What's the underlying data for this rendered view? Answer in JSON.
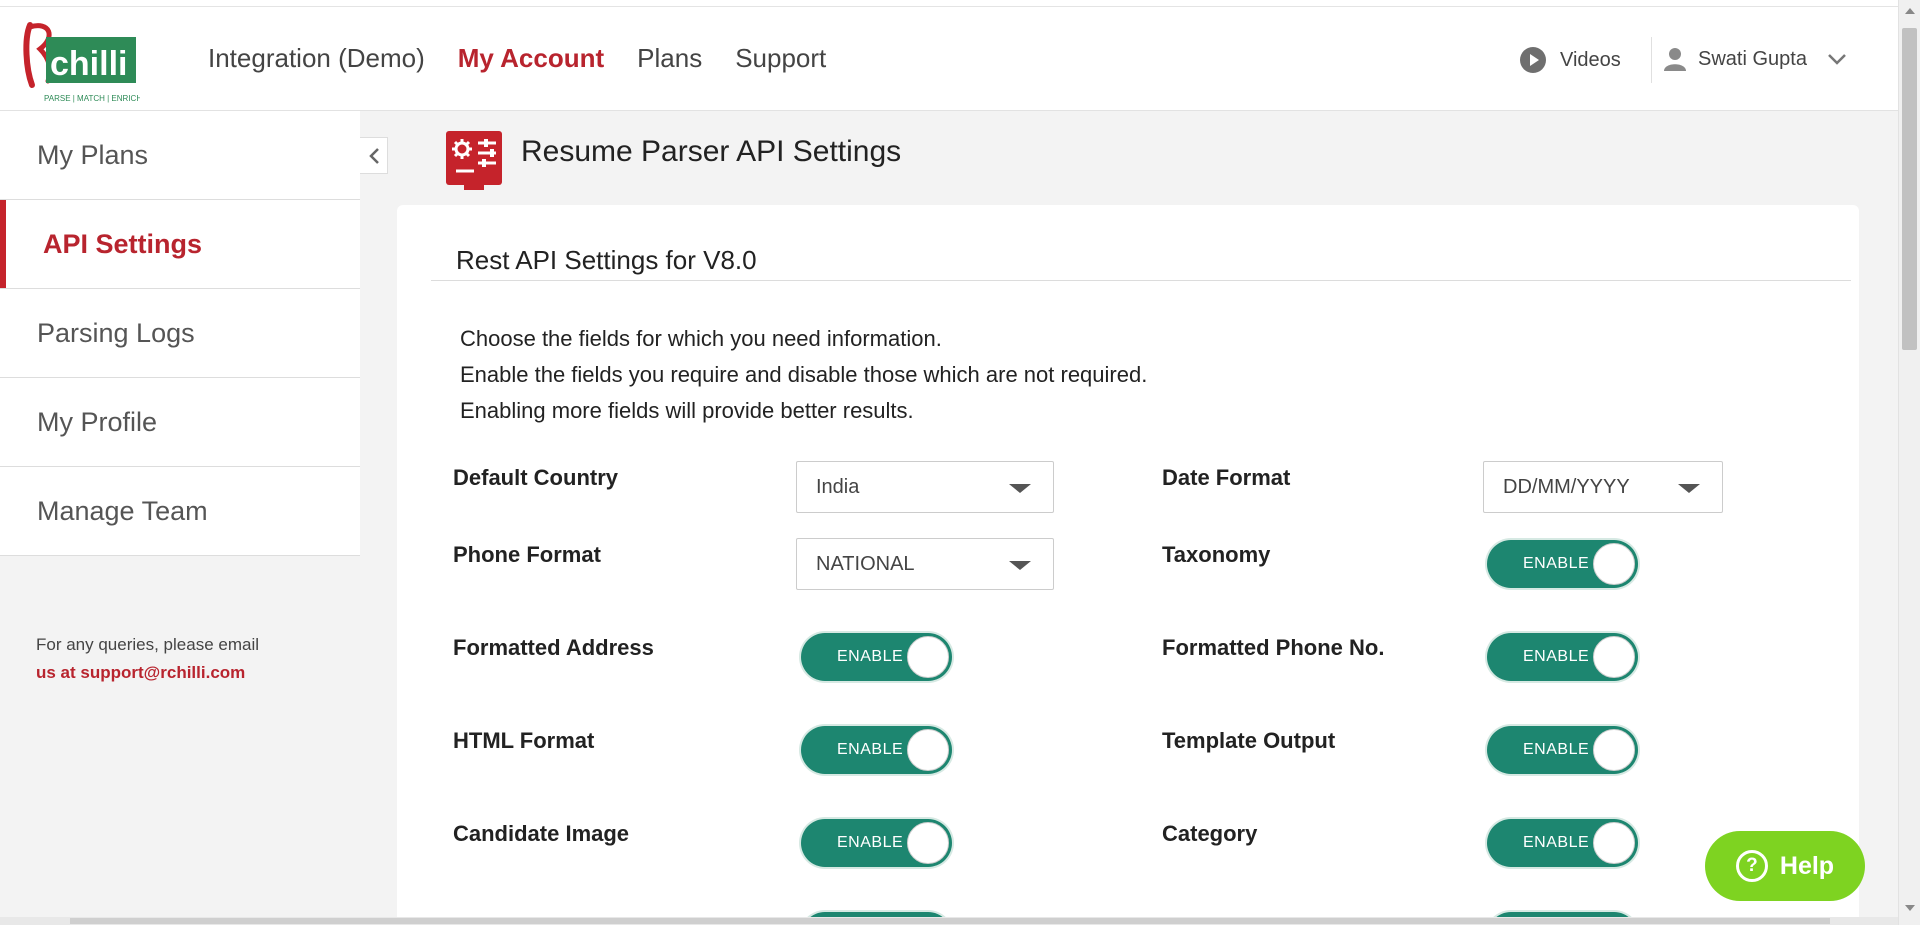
{
  "header": {
    "logo_text": "chilli",
    "logo_tagline": "PARSE | MATCH | ENRICH",
    "nav": [
      {
        "label": "Integration (Demo)",
        "active": false
      },
      {
        "label": "My Account",
        "active": true
      },
      {
        "label": "Plans",
        "active": false
      },
      {
        "label": "Support",
        "active": false
      }
    ],
    "videos_label": "Videos",
    "user_name": "Swati Gupta"
  },
  "sidebar": {
    "items": [
      {
        "label": "My Plans",
        "active": false
      },
      {
        "label": "API Settings",
        "active": true
      },
      {
        "label": "Parsing Logs",
        "active": false
      },
      {
        "label": "My Profile",
        "active": false
      },
      {
        "label": "Manage Team",
        "active": false
      }
    ],
    "contact_line1": "For any queries, please email",
    "contact_line2": "us at support@rchilli.com"
  },
  "page": {
    "title": "Resume Parser API Settings"
  },
  "card": {
    "title": "Rest API Settings for V8.0",
    "intro": [
      "Choose the fields for which you need information.",
      "Enable the fields you require and disable those which are not required.",
      "Enabling more fields will provide better results."
    ],
    "settings": {
      "default_country": {
        "label": "Default Country",
        "value": "India"
      },
      "date_format": {
        "label": "Date Format",
        "value": "DD/MM/YYYY"
      },
      "phone_format": {
        "label": "Phone Format",
        "value": "NATIONAL"
      },
      "taxonomy": {
        "label": "Taxonomy",
        "state": "ENABLE"
      },
      "formatted_address": {
        "label": "Formatted Address",
        "state": "ENABLE"
      },
      "formatted_phone": {
        "label": "Formatted Phone No.",
        "state": "ENABLE"
      },
      "html_format": {
        "label": "HTML Format",
        "state": "ENABLE"
      },
      "template_output": {
        "label": "Template Output",
        "state": "ENABLE"
      },
      "candidate_image": {
        "label": "Candidate Image",
        "state": "ENABLE"
      },
      "category": {
        "label": "Category",
        "state": "ENABLE"
      }
    }
  },
  "help_label": "Help",
  "colors": {
    "brand_red": "#c5232b",
    "toggle_green": "#1d8670",
    "help_green": "#7ed321"
  }
}
